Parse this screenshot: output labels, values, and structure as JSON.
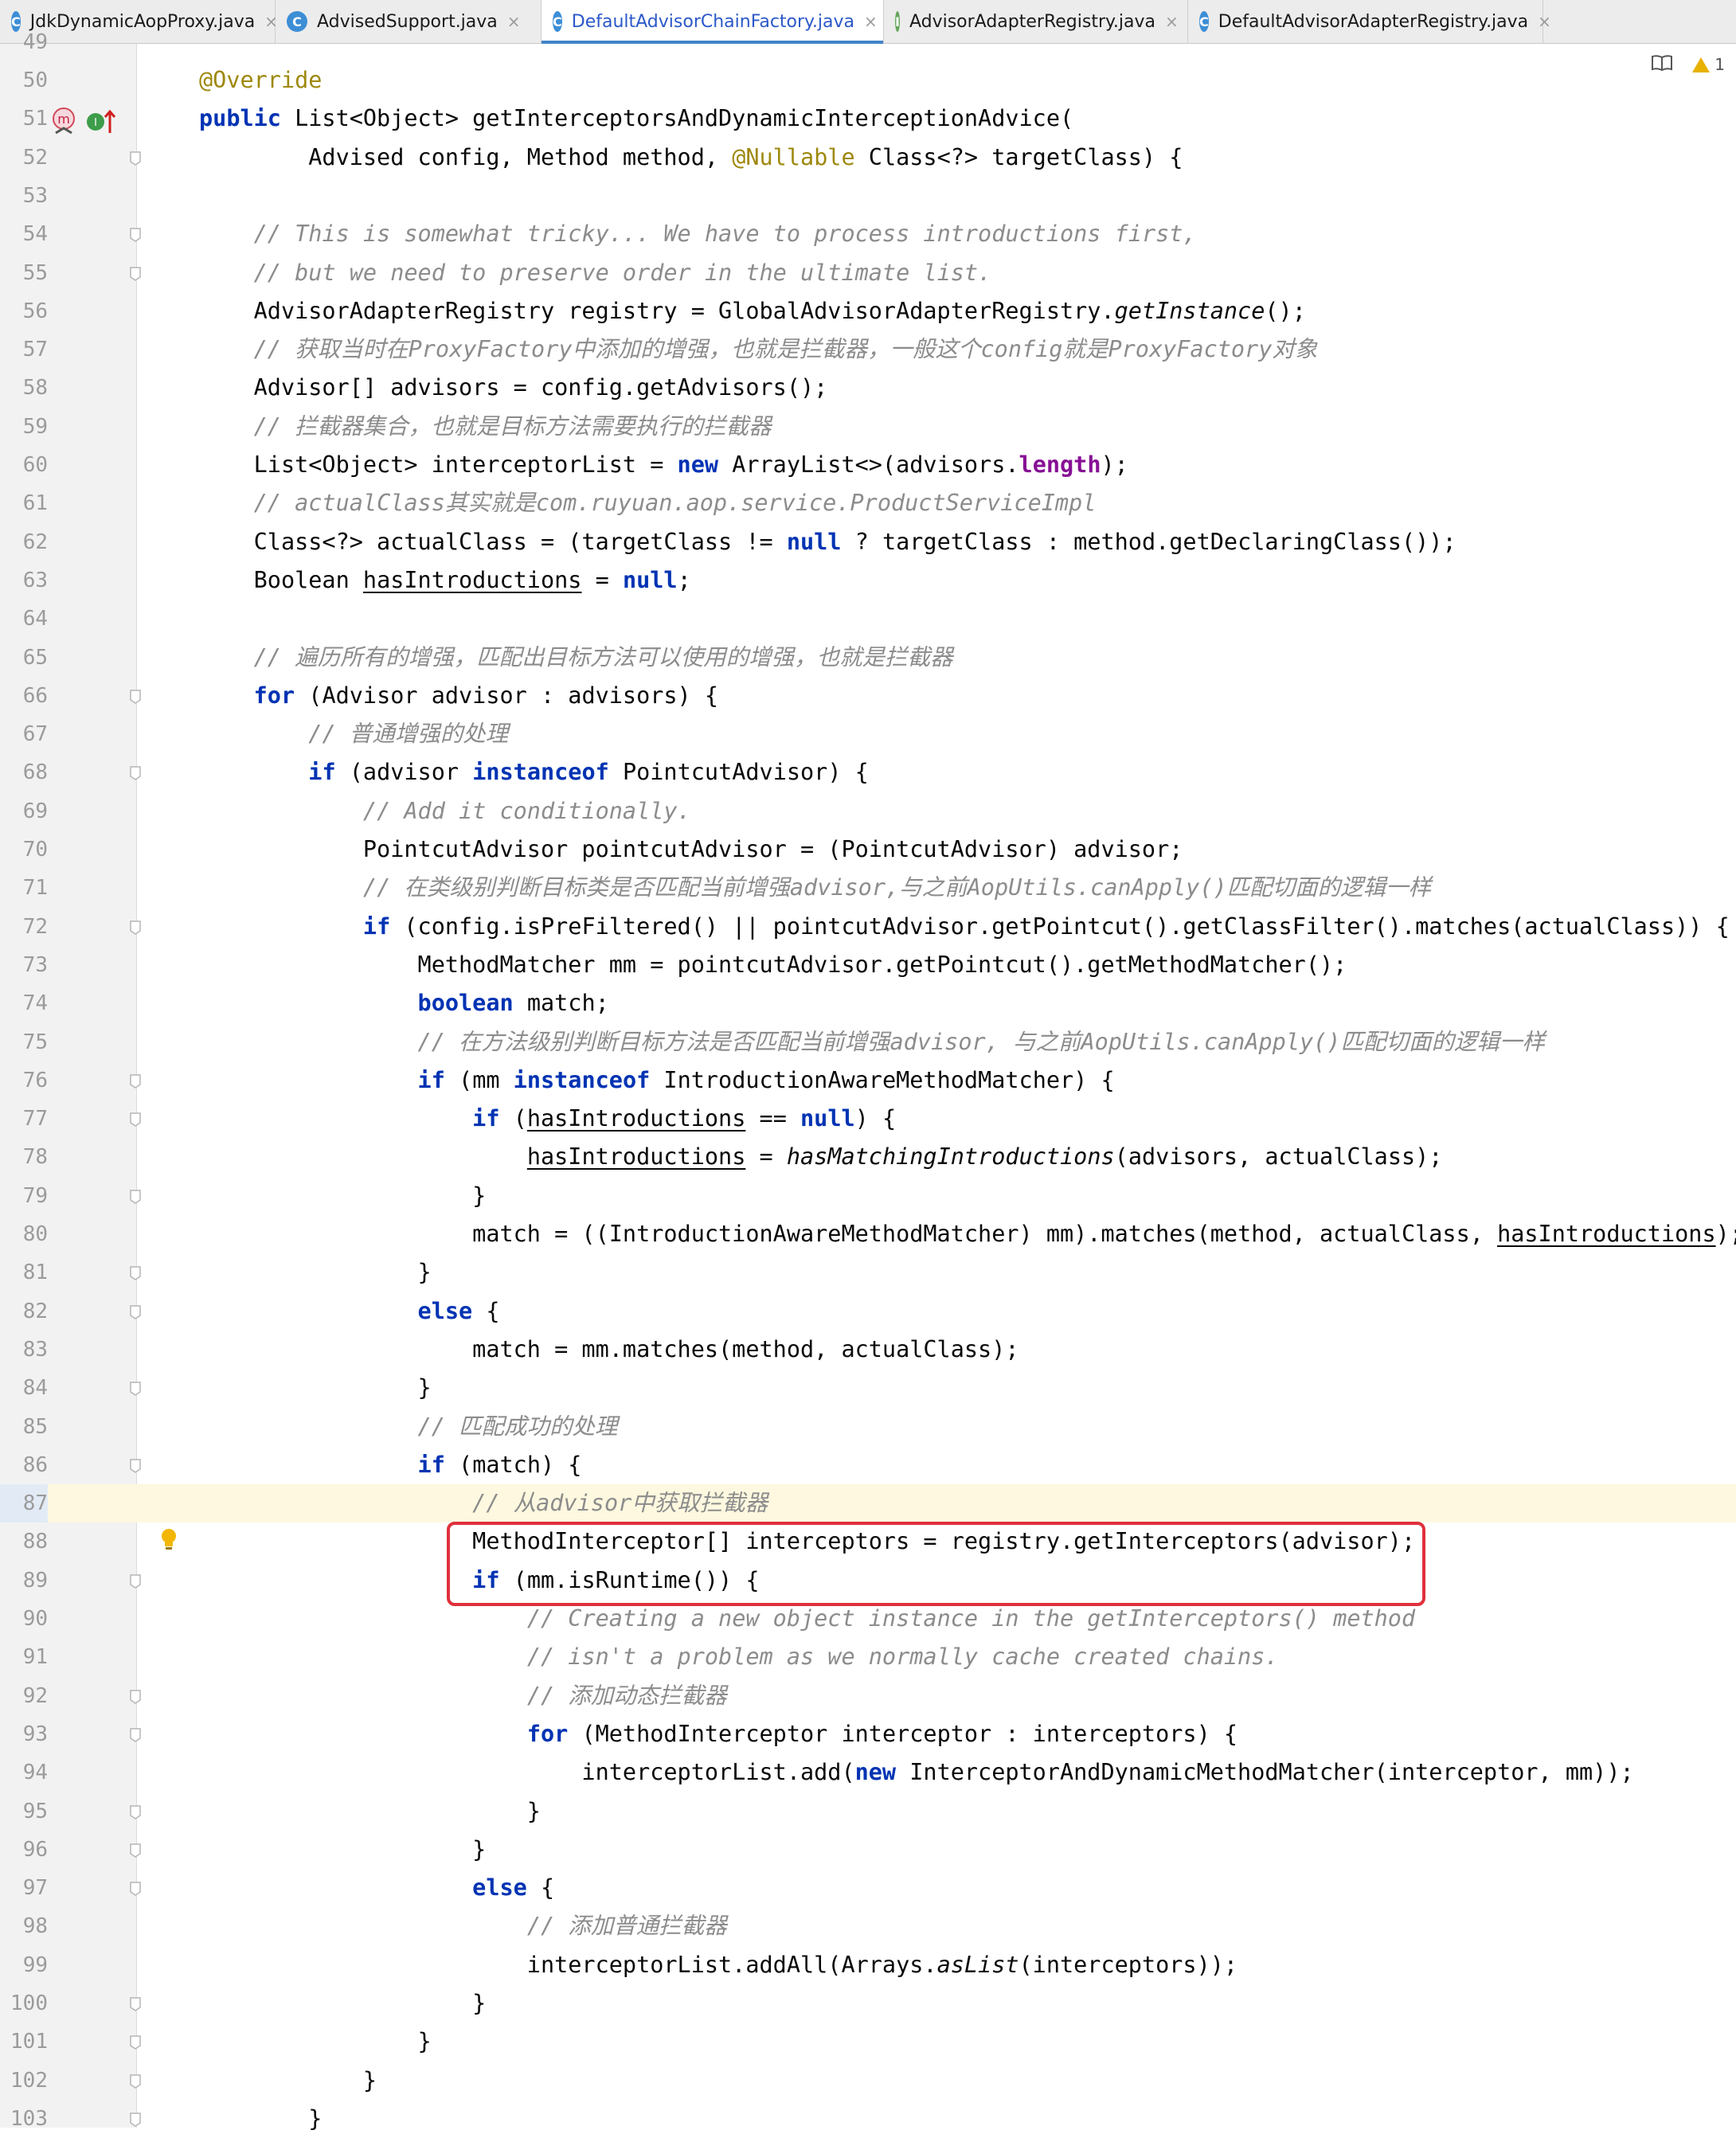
{
  "tabs": [
    {
      "label": "JdkDynamicAopProxy.java",
      "kind": "C",
      "active": false
    },
    {
      "label": "AdvisedSupport.java",
      "kind": "C",
      "active": false
    },
    {
      "label": "DefaultAdvisorChainFactory.java",
      "kind": "C",
      "active": true
    },
    {
      "label": "AdvisorAdapterRegistry.java",
      "kind": "I",
      "active": false
    },
    {
      "label": "DefaultAdvisorAdapterRegistry.java",
      "kind": "C",
      "active": false
    }
  ],
  "tab_close_glyph": "×",
  "inspection": {
    "warnings": "1"
  },
  "editor": {
    "caret_line": 87,
    "first_partial_line": "49",
    "lines": [
      {
        "n": "50",
        "text": "@Override"
      },
      {
        "n": "51",
        "text": "public List<Object> getInterceptorsAndDynamicInterceptionAdvice("
      },
      {
        "n": "52",
        "text": "        Advised config, Method method, @Nullable Class<?> targetClass) {"
      },
      {
        "n": "53",
        "text": ""
      },
      {
        "n": "54",
        "text": "    // This is somewhat tricky... We have to process introductions first,"
      },
      {
        "n": "55",
        "text": "    // but we need to preserve order in the ultimate list."
      },
      {
        "n": "56",
        "text": "    AdvisorAdapterRegistry registry = GlobalAdvisorAdapterRegistry.getInstance();"
      },
      {
        "n": "57",
        "text": "    // 获取当时在ProxyFactory中添加的增强，也就是拦截器，一般这个config就是ProxyFactory对象"
      },
      {
        "n": "58",
        "text": "    Advisor[] advisors = config.getAdvisors();"
      },
      {
        "n": "59",
        "text": "    // 拦截器集合，也就是目标方法需要执行的拦截器"
      },
      {
        "n": "60",
        "text": "    List<Object> interceptorList = new ArrayList<>(advisors.length);"
      },
      {
        "n": "61",
        "text": "    // actualClass其实就是com.ruyuan.aop.service.ProductServiceImpl"
      },
      {
        "n": "62",
        "text": "    Class<?> actualClass = (targetClass != null ? targetClass : method.getDeclaringClass());"
      },
      {
        "n": "63",
        "text": "    Boolean hasIntroductions = null;"
      },
      {
        "n": "64",
        "text": ""
      },
      {
        "n": "65",
        "text": "    // 遍历所有的增强，匹配出目标方法可以使用的增强，也就是拦截器"
      },
      {
        "n": "66",
        "text": "    for (Advisor advisor : advisors) {"
      },
      {
        "n": "67",
        "text": "        // 普通增强的处理"
      },
      {
        "n": "68",
        "text": "        if (advisor instanceof PointcutAdvisor) {"
      },
      {
        "n": "69",
        "text": "            // Add it conditionally."
      },
      {
        "n": "70",
        "text": "            PointcutAdvisor pointcutAdvisor = (PointcutAdvisor) advisor;"
      },
      {
        "n": "71",
        "text": "            // 在类级别判断目标类是否匹配当前增强advisor,与之前AopUtils.canApply()匹配切面的逻辑一样"
      },
      {
        "n": "72",
        "text": "            if (config.isPreFiltered() || pointcutAdvisor.getPointcut().getClassFilter().matches(actualClass)) {"
      },
      {
        "n": "73",
        "text": "                MethodMatcher mm = pointcutAdvisor.getPointcut().getMethodMatcher();"
      },
      {
        "n": "74",
        "text": "                boolean match;"
      },
      {
        "n": "75",
        "text": "                // 在方法级别判断目标方法是否匹配当前增强advisor, 与之前AopUtils.canApply()匹配切面的逻辑一样"
      },
      {
        "n": "76",
        "text": "                if (mm instanceof IntroductionAwareMethodMatcher) {"
      },
      {
        "n": "77",
        "text": "                    if (hasIntroductions == null) {"
      },
      {
        "n": "78",
        "text": "                        hasIntroductions = hasMatchingIntroductions(advisors, actualClass);"
      },
      {
        "n": "79",
        "text": "                    }"
      },
      {
        "n": "80",
        "text": "                    match = ((IntroductionAwareMethodMatcher) mm).matches(method, actualClass, hasIntroductions);"
      },
      {
        "n": "81",
        "text": "                }"
      },
      {
        "n": "82",
        "text": "                else {"
      },
      {
        "n": "83",
        "text": "                    match = mm.matches(method, actualClass);"
      },
      {
        "n": "84",
        "text": "                }"
      },
      {
        "n": "85",
        "text": "                // 匹配成功的处理"
      },
      {
        "n": "86",
        "text": "                if (match) {"
      },
      {
        "n": "87",
        "text": "                    // 从advisor中获取拦截器"
      },
      {
        "n": "88",
        "text": "                    MethodInterceptor[] interceptors = registry.getInterceptors(advisor);"
      },
      {
        "n": "89",
        "text": "                    if (mm.isRuntime()) {"
      },
      {
        "n": "90",
        "text": "                        // Creating a new object instance in the getInterceptors() method"
      },
      {
        "n": "91",
        "text": "                        // isn't a problem as we normally cache created chains."
      },
      {
        "n": "92",
        "text": "                        // 添加动态拦截器"
      },
      {
        "n": "93",
        "text": "                        for (MethodInterceptor interceptor : interceptors) {"
      },
      {
        "n": "94",
        "text": "                            interceptorList.add(new InterceptorAndDynamicMethodMatcher(interceptor, mm));"
      },
      {
        "n": "95",
        "text": "                        }"
      },
      {
        "n": "96",
        "text": "                    }"
      },
      {
        "n": "97",
        "text": "                    else {"
      },
      {
        "n": "98",
        "text": "                        // 添加普通拦截器"
      },
      {
        "n": "99",
        "text": "                        interceptorList.addAll(Arrays.asList(interceptors));"
      },
      {
        "n": "100",
        "text": "                    }"
      },
      {
        "n": "101",
        "text": "                }"
      },
      {
        "n": "102",
        "text": "            }"
      },
      {
        "n": "103",
        "text": "        }"
      }
    ]
  },
  "colors": {
    "keyword": "#0033b3",
    "annotation": "#9e880d",
    "comment": "#8c8c8c",
    "field": "#871094",
    "highlight_box": "#e0303c",
    "active_tab": "#2b58c9"
  },
  "icons": [
    "reader-mode-icon",
    "warning-icon",
    "lightbulb-icon",
    "override-method-icon",
    "implemented-method-icon",
    "fold-icon",
    "class-file-icon",
    "interface-file-icon",
    "close-icon"
  ]
}
